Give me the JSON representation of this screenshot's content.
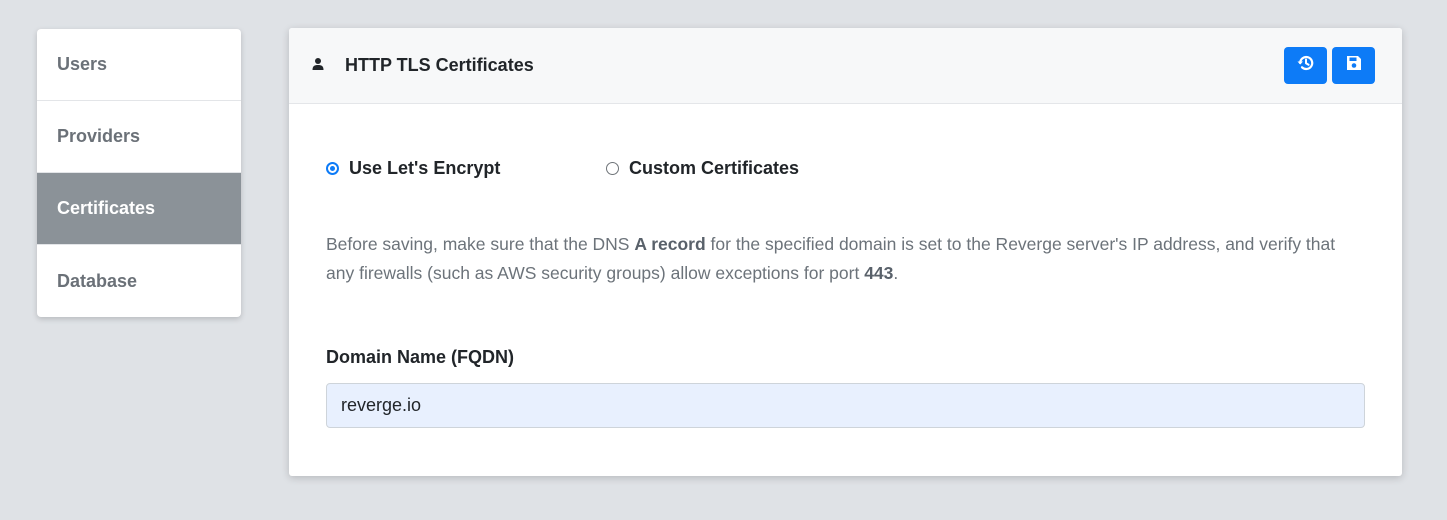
{
  "sidebar": {
    "items": [
      {
        "label": "Users",
        "active": false
      },
      {
        "label": "Providers",
        "active": false
      },
      {
        "label": "Certificates",
        "active": true
      },
      {
        "label": "Database",
        "active": false
      }
    ]
  },
  "card": {
    "header": {
      "icon": "user-icon",
      "title": "HTTP TLS Certificates",
      "buttons": [
        {
          "icon": "history-icon",
          "color": "#0d7bf7"
        },
        {
          "icon": "save-icon",
          "color": "#0d7bf7"
        }
      ]
    },
    "cert_options": {
      "letsencrypt_label": "Use Let's Encrypt",
      "custom_label": "Custom Certificates",
      "selected": "Use Let's Encrypt"
    },
    "info": {
      "part1": "Before saving, make sure that the DNS ",
      "bold1": "A record",
      "part2": " for the specified domain is set to the Reverge server's IP address, and verify that any firewalls (such as AWS security groups) allow exceptions for port ",
      "bold2": "443",
      "part3": "."
    },
    "domain": {
      "label": "Domain Name (FQDN)",
      "value": "reverge.io"
    }
  },
  "colors": {
    "accent": "#0d7bf7",
    "sidebar_active": "#8b9298",
    "background": "#dfe2e6",
    "input_background": "#e8f0fe"
  }
}
